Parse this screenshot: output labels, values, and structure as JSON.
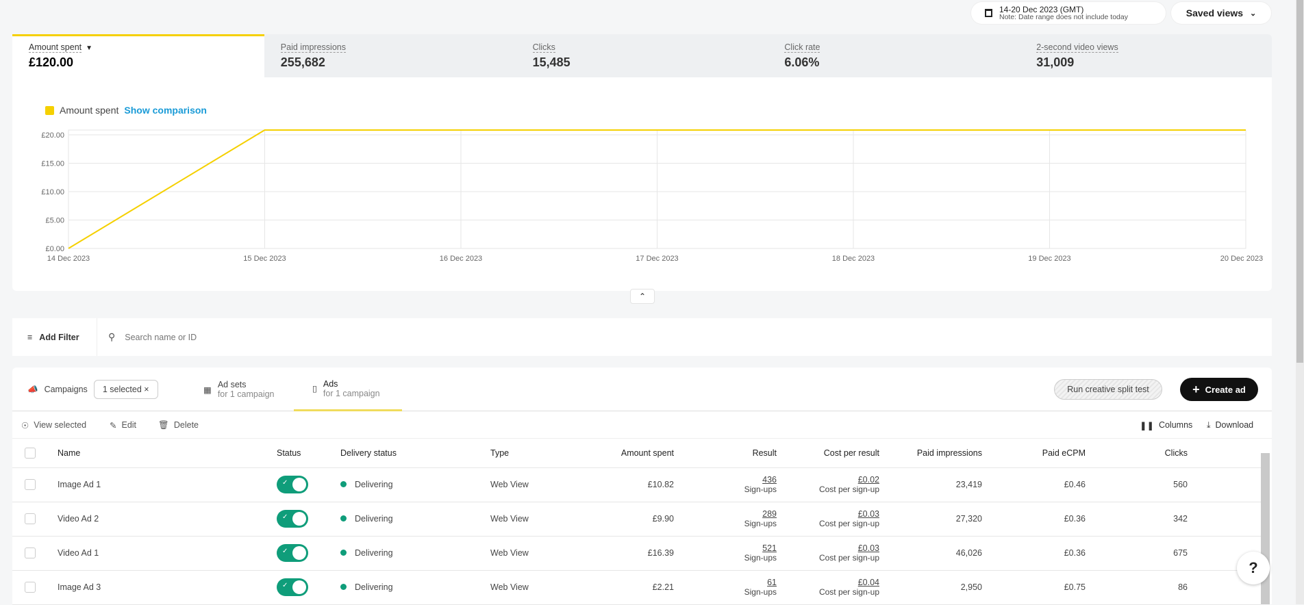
{
  "header": {
    "date_range": "14-20 Dec 2023 (GMT)",
    "date_note": "Note: Date range does not include today",
    "saved_views": "Saved views"
  },
  "metrics": [
    {
      "label": "Amount spent",
      "value": "£120.00"
    },
    {
      "label": "Paid impressions",
      "value": "255,682"
    },
    {
      "label": "Clicks",
      "value": "15,485"
    },
    {
      "label": "Click rate",
      "value": "6.06%"
    },
    {
      "label": "2-second video views",
      "value": "31,009"
    }
  ],
  "chart_data": {
    "type": "line",
    "legend": "Amount spent",
    "show_comparison": "Show comparison",
    "x": [
      "14 Dec 2023",
      "15 Dec 2023",
      "16 Dec 2023",
      "17 Dec 2023",
      "18 Dec 2023",
      "19 Dec 2023",
      "20 Dec 2023"
    ],
    "series": [
      {
        "name": "Amount spent",
        "values": [
          0,
          20,
          20,
          20,
          20,
          20,
          20
        ],
        "color": "#f5d000"
      }
    ],
    "yticks": [
      "£0.00",
      "£5.00",
      "£10.00",
      "£15.00",
      "£20.00"
    ],
    "ylim": [
      0,
      20
    ],
    "grid": true
  },
  "filter": {
    "add_filter": "Add Filter",
    "search_placeholder": "Search name or ID"
  },
  "tabs": {
    "campaigns": "Campaigns",
    "chip": "1 selected",
    "adsets": "Ad sets",
    "adsets_sub": "for 1 campaign",
    "ads": "Ads",
    "ads_sub": "for 1 campaign",
    "split_test": "Run creative split test",
    "create": "Create ad"
  },
  "toolbar": {
    "view_selected": "View selected",
    "edit": "Edit",
    "delete": "Delete",
    "columns": "Columns",
    "download": "Download"
  },
  "table": {
    "headers": [
      "Name",
      "Status",
      "Delivery status",
      "Type",
      "Amount spent",
      "Result",
      "Cost per result",
      "Paid impressions",
      "Paid eCPM",
      "Clicks"
    ],
    "rows": [
      {
        "name": "Image Ad 1",
        "delivery": "Delivering",
        "type": "Web View",
        "spent": "£10.82",
        "result": "436",
        "result_sub": "Sign-ups",
        "cpr": "£0.02",
        "cpr_sub": "Cost per sign-up",
        "impr": "23,419",
        "ecpm": "£0.46",
        "clicks": "560"
      },
      {
        "name": "Video Ad 2",
        "delivery": "Delivering",
        "type": "Web View",
        "spent": "£9.90",
        "result": "289",
        "result_sub": "Sign-ups",
        "cpr": "£0.03",
        "cpr_sub": "Cost per sign-up",
        "impr": "27,320",
        "ecpm": "£0.36",
        "clicks": "342"
      },
      {
        "name": "Video Ad 1",
        "delivery": "Delivering",
        "type": "Web View",
        "spent": "£16.39",
        "result": "521",
        "result_sub": "Sign-ups",
        "cpr": "£0.03",
        "cpr_sub": "Cost per sign-up",
        "impr": "46,026",
        "ecpm": "£0.36",
        "clicks": "675"
      },
      {
        "name": "Image Ad 3",
        "delivery": "Delivering",
        "type": "Web View",
        "spent": "£2.21",
        "result": "61",
        "result_sub": "Sign-ups",
        "cpr": "£0.04",
        "cpr_sub": "Cost per sign-up",
        "impr": "2,950",
        "ecpm": "£0.75",
        "clicks": "86"
      }
    ]
  }
}
